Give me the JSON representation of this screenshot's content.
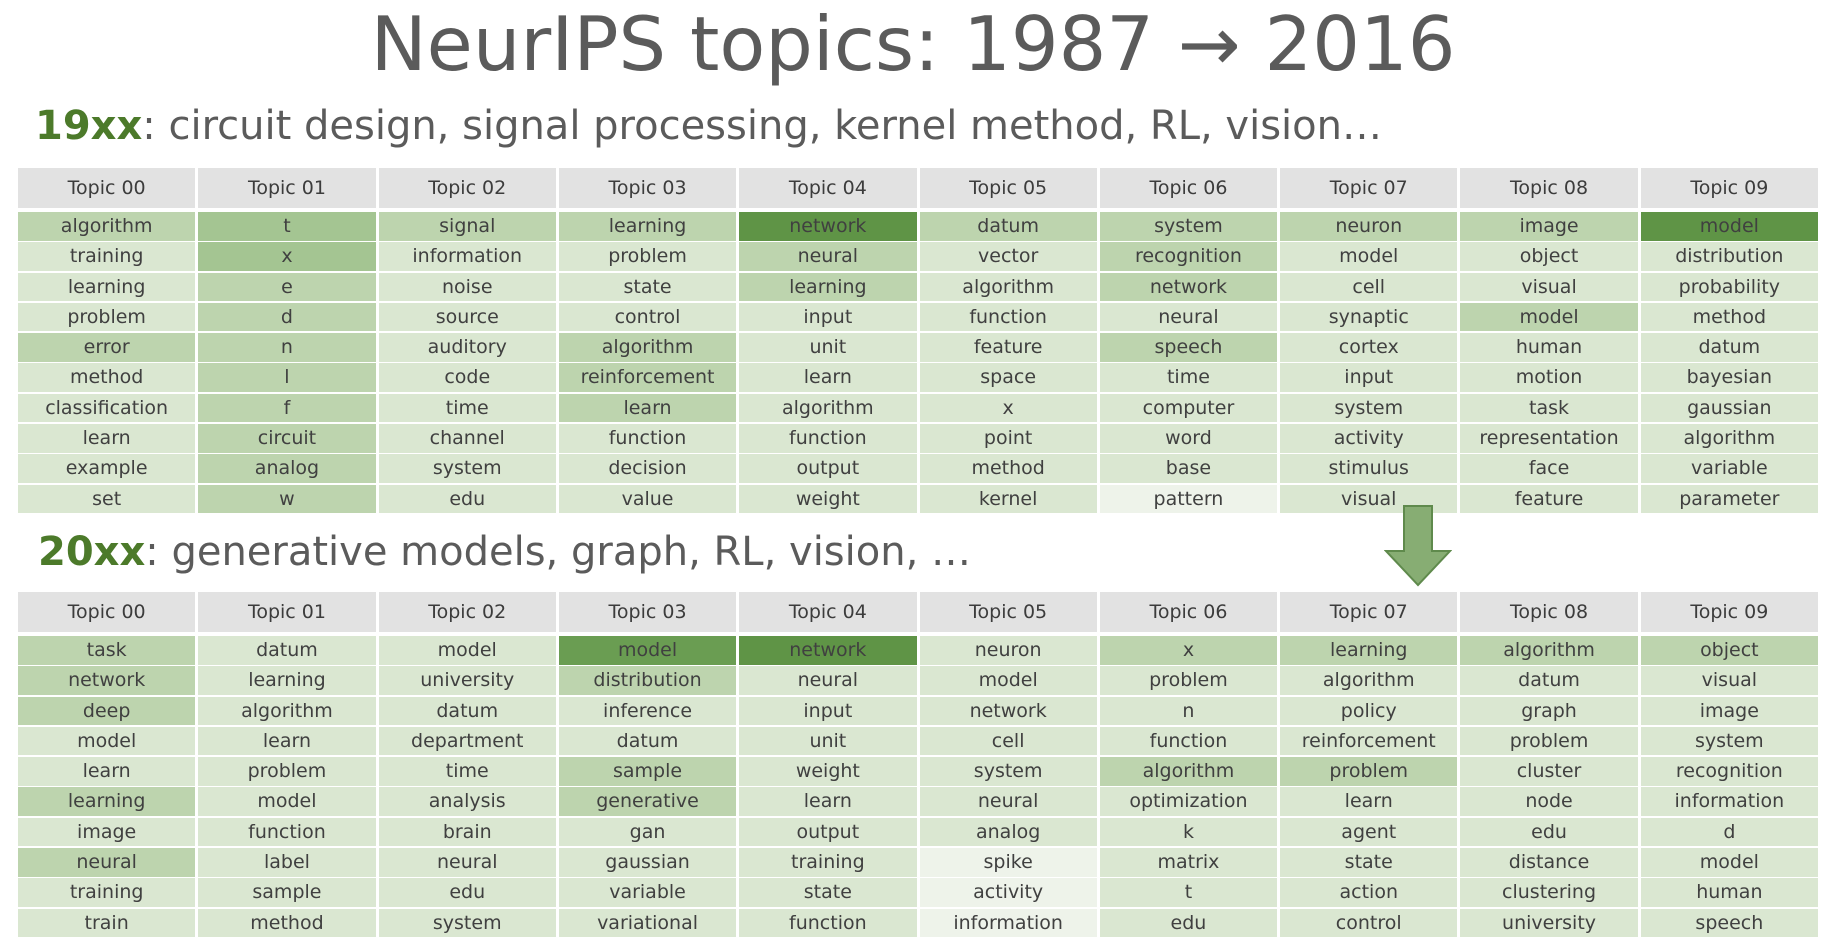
{
  "title": "NeurIPS topics: 1987 → 2016",
  "sections": [
    {
      "era": "19xx",
      "subtitle": ": circuit design, signal processing, kernel method, RL, vision…",
      "topics": [
        {
          "header": "Topic 00",
          "words": [
            "algorithm",
            "training",
            "learning",
            "problem",
            "error",
            "method",
            "classification",
            "learn",
            "example",
            "set"
          ],
          "levels": [
            3,
            2,
            2,
            2,
            3,
            2,
            2,
            2,
            2,
            2
          ]
        },
        {
          "header": "Topic 01",
          "words": [
            "t",
            "x",
            "e",
            "d",
            "n",
            "l",
            "f",
            "circuit",
            "analog",
            "w"
          ],
          "levels": [
            4,
            4,
            3,
            3,
            3,
            3,
            3,
            3,
            3,
            3
          ]
        },
        {
          "header": "Topic 02",
          "words": [
            "signal",
            "information",
            "noise",
            "source",
            "auditory",
            "code",
            "time",
            "channel",
            "system",
            "edu"
          ],
          "levels": [
            3,
            2,
            2,
            2,
            2,
            2,
            2,
            2,
            2,
            2
          ]
        },
        {
          "header": "Topic 03",
          "words": [
            "learning",
            "problem",
            "state",
            "control",
            "algorithm",
            "reinforcement",
            "learn",
            "function",
            "decision",
            "value"
          ],
          "levels": [
            3,
            2,
            2,
            2,
            3,
            3,
            3,
            2,
            2,
            2
          ]
        },
        {
          "header": "Topic 04",
          "words": [
            "network",
            "neural",
            "learning",
            "input",
            "unit",
            "learn",
            "algorithm",
            "function",
            "output",
            "weight"
          ],
          "levels": [
            6,
            3,
            3,
            2,
            2,
            2,
            2,
            2,
            2,
            2
          ]
        },
        {
          "header": "Topic 05",
          "words": [
            "datum",
            "vector",
            "algorithm",
            "function",
            "feature",
            "space",
            "x",
            "point",
            "method",
            "kernel"
          ],
          "levels": [
            3,
            2,
            2,
            2,
            2,
            2,
            2,
            2,
            2,
            2
          ]
        },
        {
          "header": "Topic 06",
          "words": [
            "system",
            "recognition",
            "network",
            "neural",
            "speech",
            "time",
            "computer",
            "word",
            "base",
            "pattern"
          ],
          "levels": [
            3,
            3,
            3,
            2,
            3,
            2,
            2,
            2,
            2,
            1
          ]
        },
        {
          "header": "Topic 07",
          "words": [
            "neuron",
            "model",
            "cell",
            "synaptic",
            "cortex",
            "input",
            "system",
            "activity",
            "stimulus",
            "visual"
          ],
          "levels": [
            3,
            2,
            2,
            2,
            2,
            2,
            2,
            2,
            2,
            2
          ]
        },
        {
          "header": "Topic 08",
          "words": [
            "image",
            "object",
            "visual",
            "model",
            "human",
            "motion",
            "task",
            "representation",
            "face",
            "feature"
          ],
          "levels": [
            3,
            2,
            2,
            3,
            2,
            2,
            2,
            2,
            2,
            2
          ]
        },
        {
          "header": "Topic 09",
          "words": [
            "model",
            "distribution",
            "probability",
            "method",
            "datum",
            "bayesian",
            "gaussian",
            "algorithm",
            "variable",
            "parameter"
          ],
          "levels": [
            6,
            2,
            2,
            2,
            2,
            2,
            2,
            2,
            2,
            2
          ]
        }
      ]
    },
    {
      "era": "20xx",
      "subtitle": ": generative models, graph, RL, vision, …",
      "topics": [
        {
          "header": "Topic 00",
          "words": [
            "task",
            "network",
            "deep",
            "model",
            "learn",
            "learning",
            "image",
            "neural",
            "training",
            "train"
          ],
          "levels": [
            3,
            3,
            3,
            2,
            2,
            3,
            2,
            3,
            2,
            2
          ]
        },
        {
          "header": "Topic 01",
          "words": [
            "datum",
            "learning",
            "algorithm",
            "learn",
            "problem",
            "model",
            "function",
            "label",
            "sample",
            "method"
          ],
          "levels": [
            2,
            2,
            2,
            2,
            2,
            2,
            2,
            2,
            2,
            2
          ]
        },
        {
          "header": "Topic 02",
          "words": [
            "model",
            "university",
            "datum",
            "department",
            "time",
            "analysis",
            "brain",
            "neural",
            "edu",
            "system"
          ],
          "levels": [
            2,
            2,
            2,
            2,
            2,
            2,
            2,
            2,
            2,
            2
          ]
        },
        {
          "header": "Topic 03",
          "words": [
            "model",
            "distribution",
            "inference",
            "datum",
            "sample",
            "generative",
            "gan",
            "gaussian",
            "variable",
            "variational"
          ],
          "levels": [
            5,
            3,
            2,
            2,
            3,
            3,
            2,
            2,
            2,
            2
          ]
        },
        {
          "header": "Topic 04",
          "words": [
            "network",
            "neural",
            "input",
            "unit",
            "weight",
            "learn",
            "output",
            "training",
            "state",
            "function"
          ],
          "levels": [
            6,
            2,
            2,
            2,
            2,
            2,
            2,
            2,
            2,
            2
          ]
        },
        {
          "header": "Topic 05",
          "words": [
            "neuron",
            "model",
            "network",
            "cell",
            "system",
            "neural",
            "analog",
            "spike",
            "activity",
            "information"
          ],
          "levels": [
            2,
            2,
            2,
            2,
            2,
            2,
            2,
            1,
            1,
            1
          ]
        },
        {
          "header": "Topic 06",
          "words": [
            "x",
            "problem",
            "n",
            "function",
            "algorithm",
            "optimization",
            "k",
            "matrix",
            "t",
            "edu"
          ],
          "levels": [
            3,
            2,
            2,
            2,
            3,
            2,
            2,
            2,
            2,
            2
          ]
        },
        {
          "header": "Topic 07",
          "words": [
            "learning",
            "algorithm",
            "policy",
            "reinforcement",
            "problem",
            "learn",
            "agent",
            "state",
            "action",
            "control"
          ],
          "levels": [
            3,
            2,
            2,
            2,
            3,
            2,
            2,
            2,
            2,
            2
          ]
        },
        {
          "header": "Topic 08",
          "words": [
            "algorithm",
            "datum",
            "graph",
            "problem",
            "cluster",
            "node",
            "edu",
            "distance",
            "clustering",
            "university"
          ],
          "levels": [
            3,
            2,
            2,
            2,
            2,
            2,
            2,
            2,
            2,
            2
          ]
        },
        {
          "header": "Topic 09",
          "words": [
            "object",
            "visual",
            "image",
            "system",
            "recognition",
            "information",
            "d",
            "model",
            "human",
            "speech"
          ],
          "levels": [
            3,
            2,
            2,
            2,
            2,
            2,
            2,
            2,
            2,
            2
          ]
        }
      ]
    }
  ],
  "colors": {
    "level_1": "#eef3ea",
    "level_2": "#dae7d1",
    "level_3": "#bdd4ae",
    "level_4": "#a4c592",
    "level_5": "#6a9d52",
    "level_6": "#5f9446",
    "header_bg": "#e2e2e2",
    "era_green": "#4c7a2a",
    "arrow_fill": "#87ad73",
    "arrow_stroke": "#5f8a4c"
  }
}
